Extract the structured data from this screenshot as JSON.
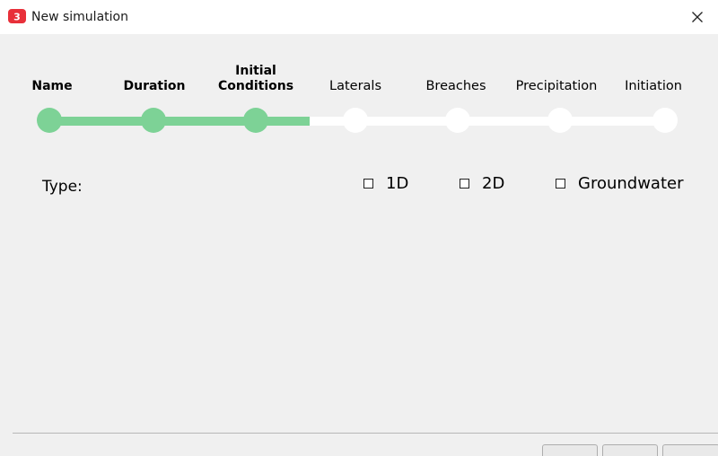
{
  "window": {
    "title": "New simulation",
    "app_icon": "3di-logo-icon",
    "close_icon": "close-icon"
  },
  "stepper": {
    "steps": [
      {
        "label": "Name",
        "status": "completed"
      },
      {
        "label": "Duration",
        "status": "completed"
      },
      {
        "label": "Initial\nConditions",
        "status": "completed"
      },
      {
        "label": "Laterals",
        "status": "pending"
      },
      {
        "label": "Breaches",
        "status": "pending"
      },
      {
        "label": "Precipitation",
        "status": "pending"
      },
      {
        "label": "Initiation",
        "status": "pending"
      }
    ],
    "colors": {
      "completed": "#7dd296",
      "pending": "#ffffff"
    }
  },
  "type_section": {
    "label": "Type:",
    "options": [
      {
        "label": "1D",
        "checked": false
      },
      {
        "label": "2D",
        "checked": false
      },
      {
        "label": "Groundwater",
        "checked": false
      }
    ]
  },
  "brand_color": "#e8303a"
}
